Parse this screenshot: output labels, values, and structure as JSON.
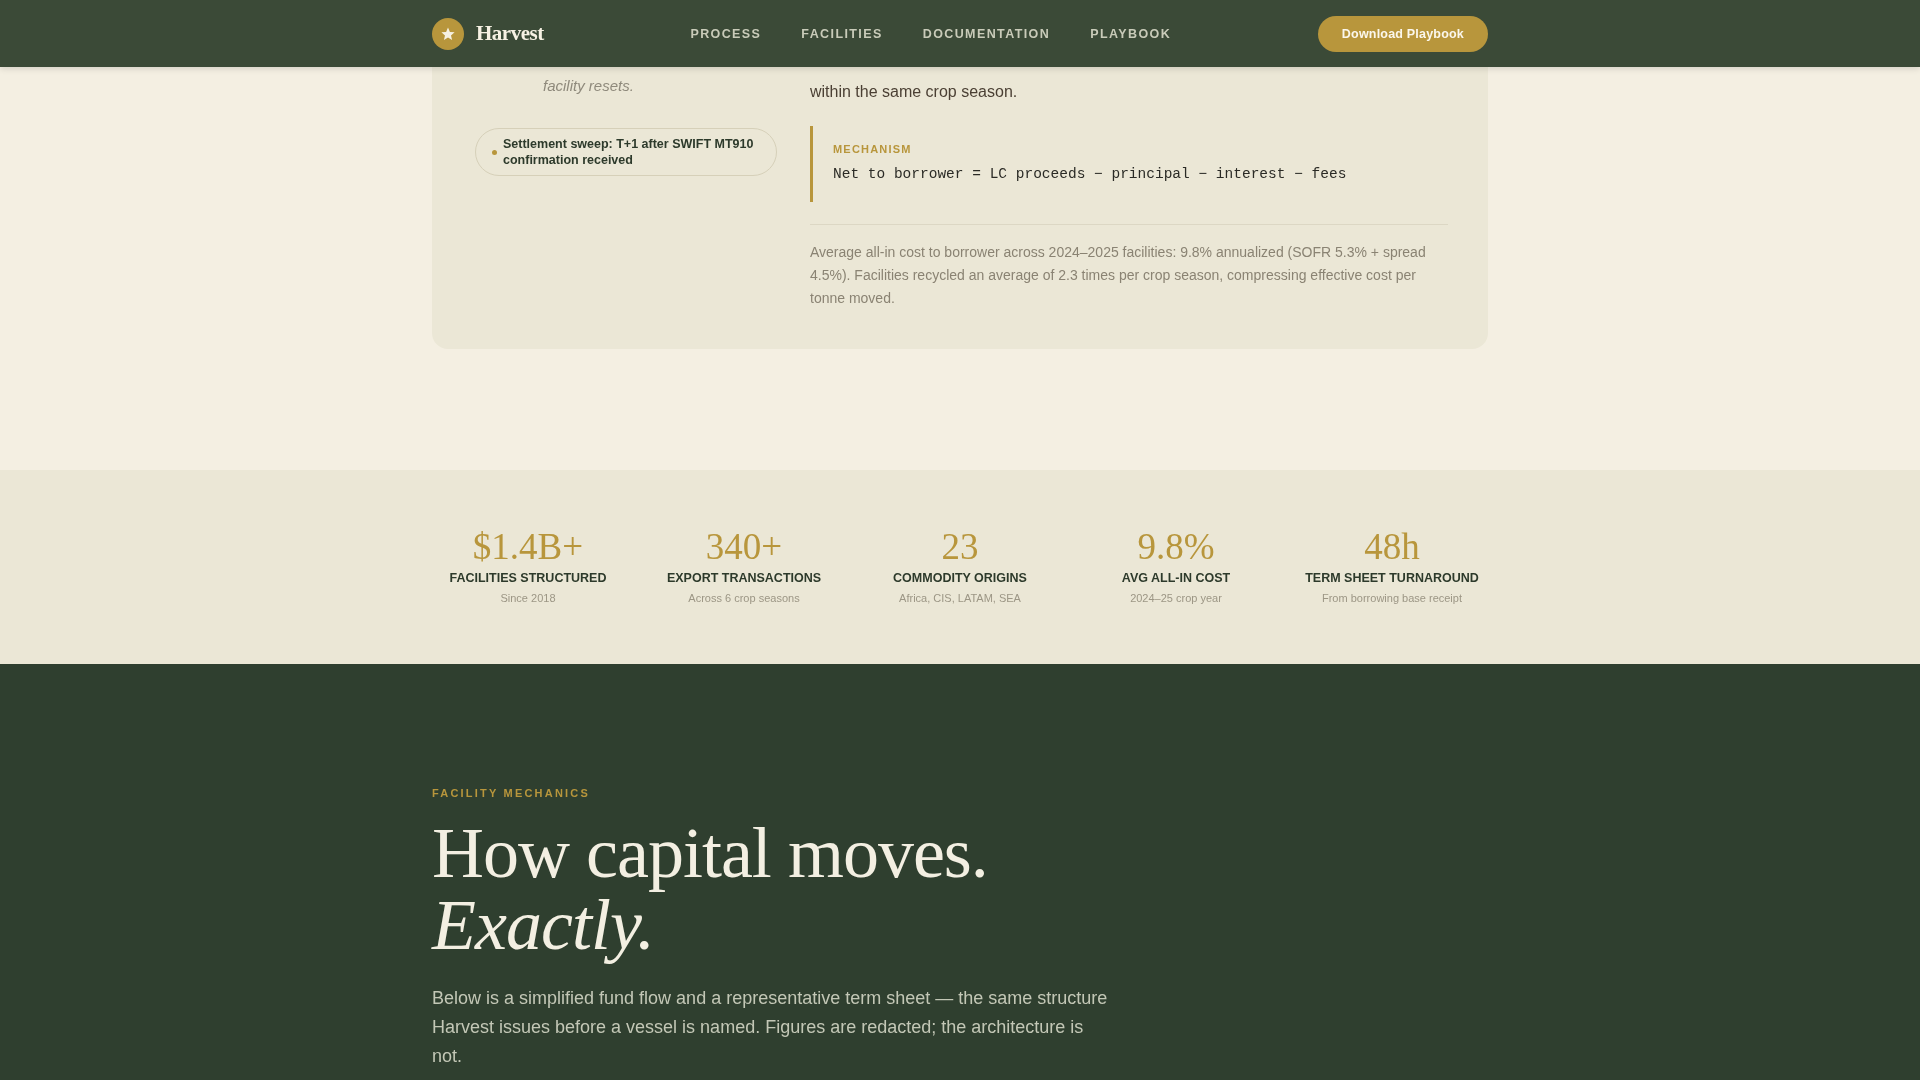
{
  "nav": {
    "brand": "Harvest",
    "links": [
      {
        "label": "PROCESS"
      },
      {
        "label": "FACILITIES"
      },
      {
        "label": "DOCUMENTATION"
      },
      {
        "label": "PLAYBOOK"
      }
    ],
    "cta": "Download Playbook"
  },
  "process_card": {
    "step_note": "facility resets.",
    "settlement_tag": "Settlement sweep: T+1 after SWIFT MT910 confirmation received",
    "body_tail": "within the same crop season.",
    "mechanism": {
      "label": "MECHANISM",
      "formula": "Net to borrower = LC proceeds − principal − interest − fees"
    },
    "footnote": "Average all-in cost to borrower across 2024–2025 facilities: 9.8% annualized (SOFR 5.3% + spread 4.5%). Facilities recycled an average of 2.3 times per crop season, compressing effective cost per tonne moved."
  },
  "stats": [
    {
      "value": "$1.4B+",
      "label": "FACILITIES STRUCTURED",
      "caption": "Since 2018"
    },
    {
      "value": "340+",
      "label": "EXPORT TRANSACTIONS",
      "caption": "Across 6 crop seasons"
    },
    {
      "value": "23",
      "label": "COMMODITY ORIGINS",
      "caption": "Africa, CIS, LATAM, SEA"
    },
    {
      "value": "9.8%",
      "label": "AVG ALL-IN COST",
      "caption": "2024–25 crop year"
    },
    {
      "value": "48h",
      "label": "TERM SHEET TURNAROUND",
      "caption": "From borrowing base receipt"
    }
  ],
  "mechanics": {
    "eyebrow": "FACILITY MECHANICS",
    "title": "How capital moves.",
    "title_emphasis": "Exactly.",
    "intro": "Below is a simplified fund flow and a representative term sheet — the same structure Harvest issues before a vessel is named. Figures are redacted; the architecture is not."
  }
}
